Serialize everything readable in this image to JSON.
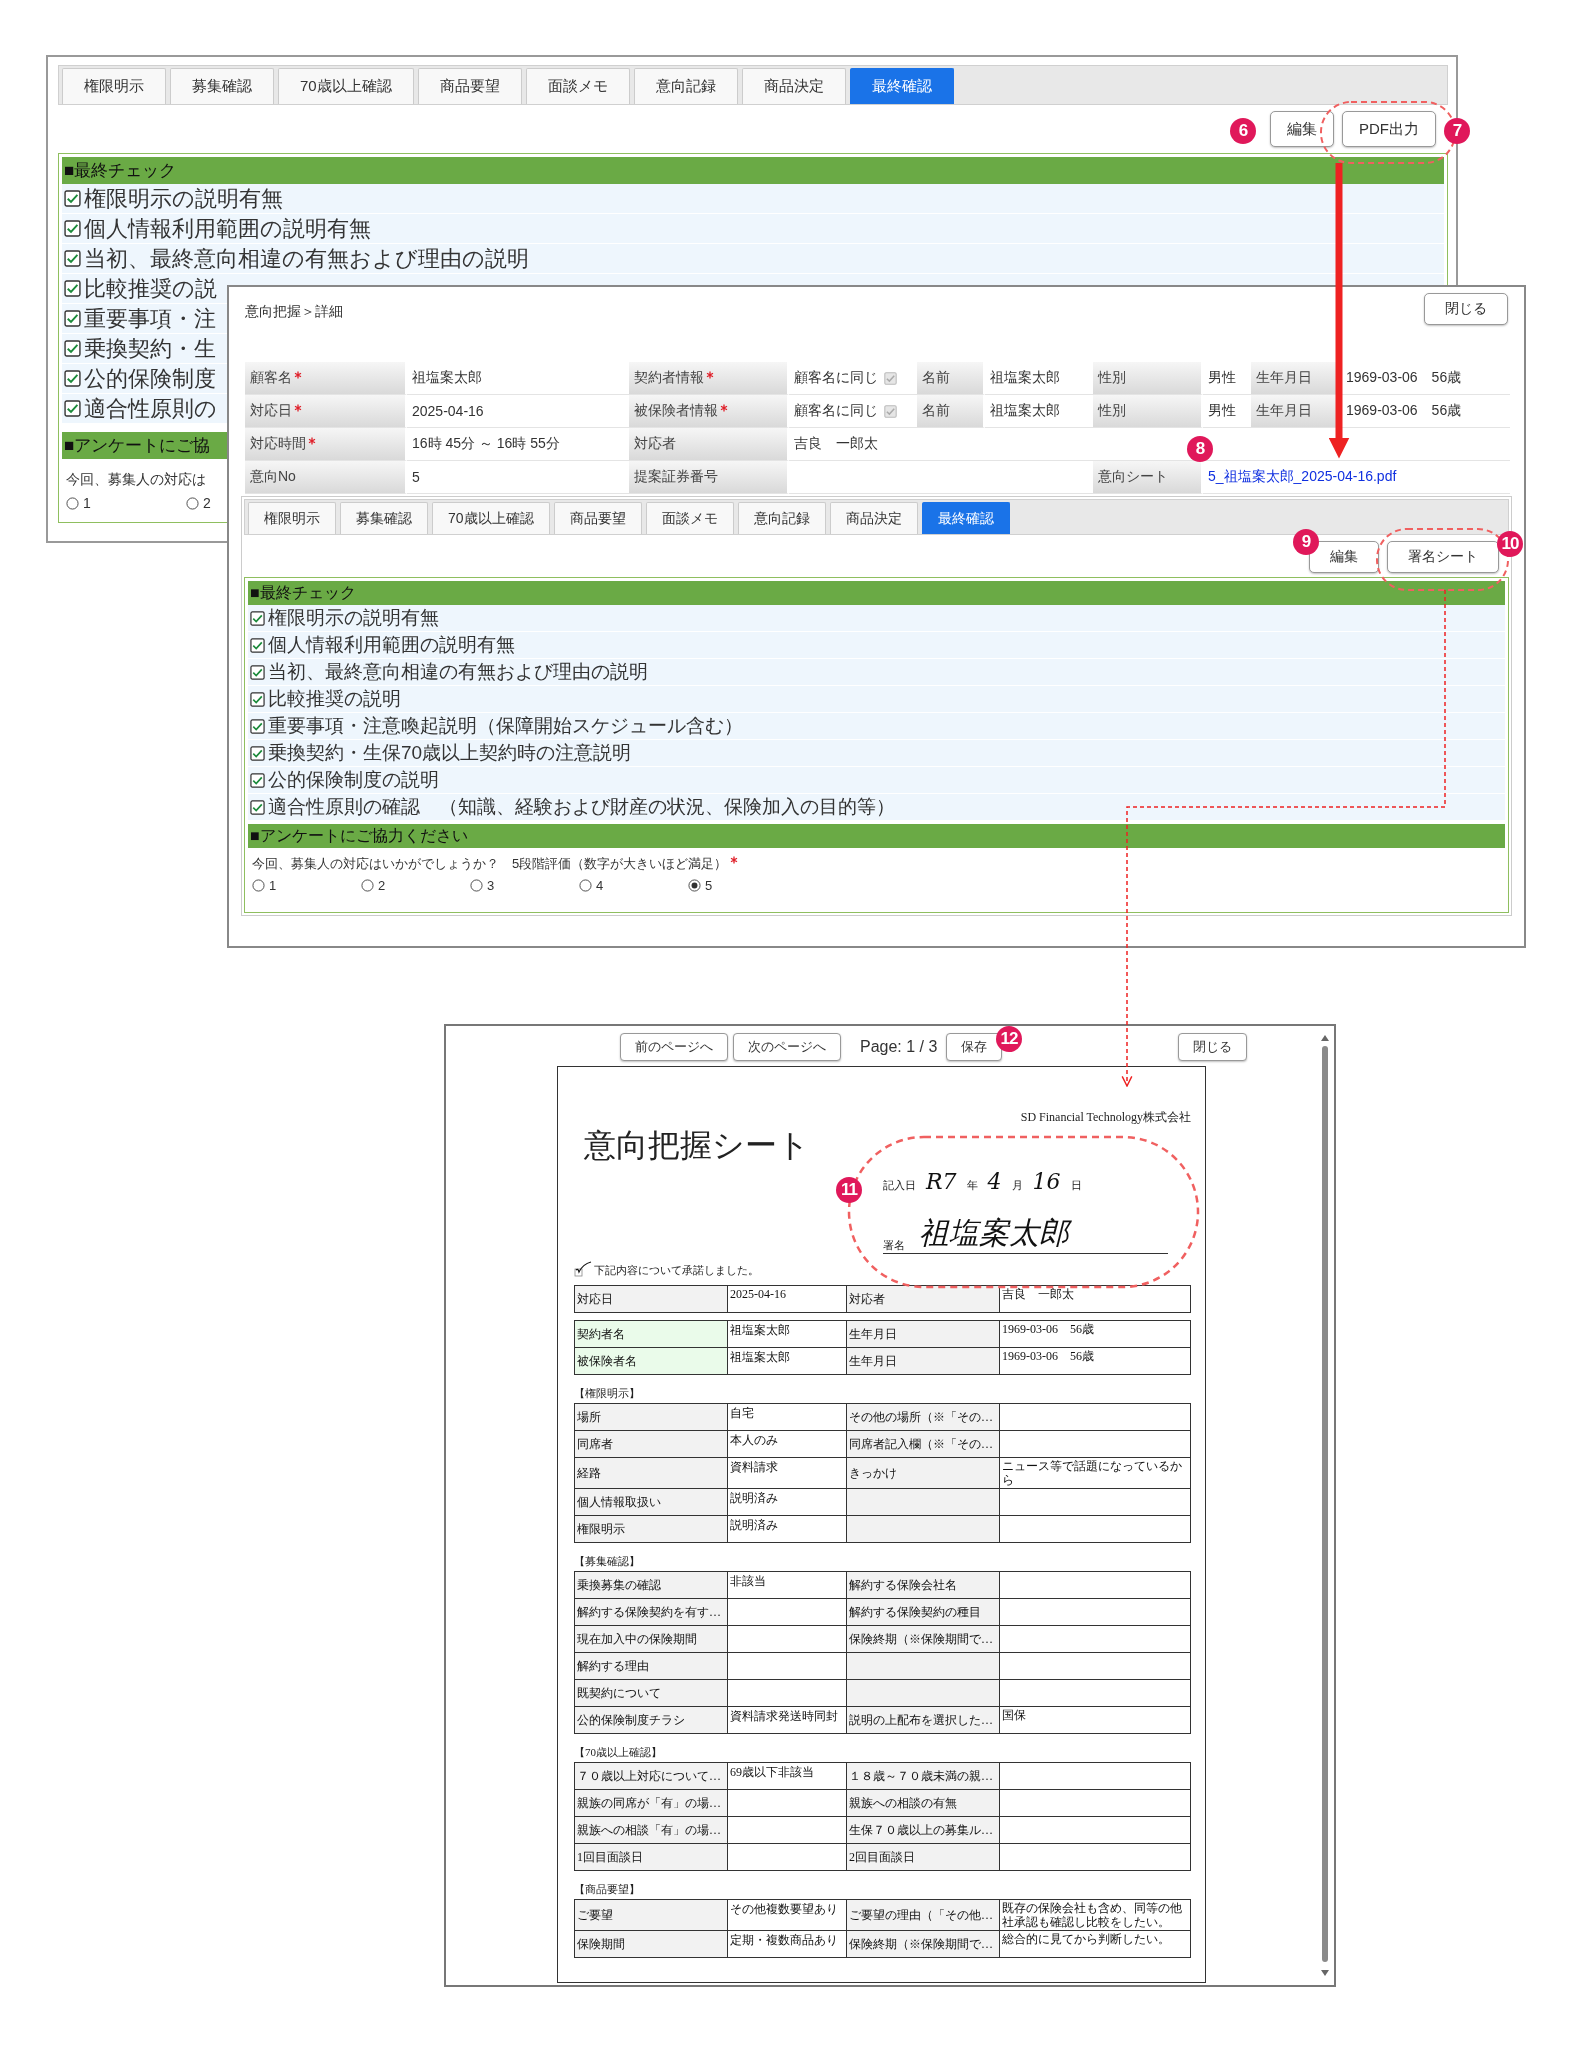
{
  "background_window": {
    "tabs": [
      {
        "label": "権限明示",
        "selected": false
      },
      {
        "label": "募集確認",
        "selected": false
      },
      {
        "label": "70歳以上確認",
        "selected": false
      },
      {
        "label": "商品要望",
        "selected": false
      },
      {
        "label": "面談メモ",
        "selected": false
      },
      {
        "label": "意向記録",
        "selected": false
      },
      {
        "label": "商品決定",
        "selected": false
      },
      {
        "label": "最終確認",
        "selected": true
      }
    ],
    "buttons": [
      {
        "label": "編集"
      },
      {
        "label": "PDF出力"
      }
    ],
    "final_check": {
      "title": "■最終チェック",
      "items": [
        {
          "label": "権限明示の説明有無",
          "checked": true
        },
        {
          "label": "個人情報利用範囲の説明有無",
          "checked": true
        },
        {
          "label": "当初、最終意向相違の有無および理由の説明",
          "checked": true
        },
        {
          "label": "比較推奨の説",
          "checked": true
        },
        {
          "label": "重要事項・注",
          "checked": true
        },
        {
          "label": "乗換契約・生",
          "checked": true
        },
        {
          "label": "公的保険制度",
          "checked": true
        },
        {
          "label": "適合性原則の",
          "checked": true
        }
      ]
    },
    "survey": {
      "title": "■アンケートにご協",
      "question": "今回、募集人の対応は",
      "options": [
        {
          "label": "1",
          "selected": false
        },
        {
          "label": "2",
          "selected": false
        }
      ]
    }
  },
  "detail_window": {
    "breadcrumb": "意向把握＞詳細",
    "close_button": "閉じる",
    "info_rows": [
      {
        "cells": [
          {
            "kind": "label",
            "text": "顧客名",
            "required": true
          },
          {
            "kind": "value",
            "text": "祖塩案太郎"
          },
          {
            "kind": "label",
            "text": "契約者情報",
            "required": true
          },
          {
            "kind": "check",
            "text": "顧客名に同じ",
            "checked": true
          },
          {
            "kind": "label",
            "text": "名前",
            "required": false
          },
          {
            "kind": "value",
            "text": "祖塩案太郎"
          },
          {
            "kind": "label",
            "text": "性別",
            "required": false
          },
          {
            "kind": "value",
            "text": "男性"
          },
          {
            "kind": "label",
            "text": "生年月日",
            "required": false
          },
          {
            "kind": "value",
            "text": "1969-03-06　56歳"
          }
        ]
      },
      {
        "cells": [
          {
            "kind": "label",
            "text": "対応日",
            "required": true
          },
          {
            "kind": "value",
            "text": "2025-04-16"
          },
          {
            "kind": "label",
            "text": "被保険者情報",
            "required": true
          },
          {
            "kind": "check",
            "text": "顧客名に同じ",
            "checked": true
          },
          {
            "kind": "label",
            "text": "名前",
            "required": false
          },
          {
            "kind": "value",
            "text": "祖塩案太郎"
          },
          {
            "kind": "label",
            "text": "性別",
            "required": false
          },
          {
            "kind": "value",
            "text": "男性"
          },
          {
            "kind": "label",
            "text": "生年月日",
            "required": false
          },
          {
            "kind": "value",
            "text": "1969-03-06　56歳"
          }
        ]
      },
      {
        "cells": [
          {
            "kind": "label",
            "text": "対応時間",
            "required": true
          },
          {
            "kind": "value",
            "text": "16時 45分 ～ 16時 55分"
          },
          {
            "kind": "label",
            "text": "対応者",
            "required": false
          },
          {
            "kind": "value",
            "text": "吉良　一郎太"
          }
        ]
      },
      {
        "cells": [
          {
            "kind": "label",
            "text": "意向No",
            "required": false
          },
          {
            "kind": "value",
            "text": "5"
          },
          {
            "kind": "label",
            "text": "提案証券番号",
            "required": false
          },
          {
            "kind": "blank"
          },
          {
            "kind": "label",
            "text": "意向シート",
            "required": false
          },
          {
            "kind": "link",
            "text": "5_祖塩案太郎_2025-04-16.pdf"
          }
        ]
      }
    ],
    "tabs": [
      {
        "label": "権限明示",
        "selected": false
      },
      {
        "label": "募集確認",
        "selected": false
      },
      {
        "label": "70歳以上確認",
        "selected": false
      },
      {
        "label": "商品要望",
        "selected": false
      },
      {
        "label": "面談メモ",
        "selected": false
      },
      {
        "label": "意向記録",
        "selected": false
      },
      {
        "label": "商品決定",
        "selected": false
      },
      {
        "label": "最終確認",
        "selected": true
      }
    ],
    "buttons": [
      {
        "label": "編集"
      },
      {
        "label": "署名シート"
      }
    ],
    "final_check": {
      "title": "■最終チェック",
      "items": [
        {
          "label": "権限明示の説明有無",
          "checked": true
        },
        {
          "label": "個人情報利用範囲の説明有無",
          "checked": true
        },
        {
          "label": "当初、最終意向相違の有無および理由の説明",
          "checked": true
        },
        {
          "label": "比較推奨の説明",
          "checked": true
        },
        {
          "label": "重要事項・注意喚起説明（保障開始スケジュール含む）",
          "checked": true
        },
        {
          "label": "乗換契約・生保70歳以上契約時の注意説明",
          "checked": true
        },
        {
          "label": "公的保険制度の説明",
          "checked": true
        },
        {
          "label": "適合性原則の確認　（知識、経験および財産の状況、保険加入の目的等）",
          "checked": true
        }
      ]
    },
    "survey": {
      "title": "■アンケートにご協力ください",
      "question": "今回、募集人の対応はいかがでしょうか？　5段階評価（数字が大きいほど満足）",
      "required": true,
      "options": [
        {
          "label": "1",
          "selected": false
        },
        {
          "label": "2",
          "selected": false
        },
        {
          "label": "3",
          "selected": false
        },
        {
          "label": "4",
          "selected": false
        },
        {
          "label": "5",
          "selected": true
        }
      ]
    }
  },
  "pdf_viewer": {
    "toolbar": {
      "prev_button": "前のページへ",
      "next_button": "次のページへ",
      "page_indicator": "Page: 1 / 3",
      "save_button": "保存",
      "close_button": "閉じる"
    },
    "page": {
      "company": "SD Financial Technology株式会社",
      "title": "意向把握シート",
      "entry_date": {
        "label": "記入日",
        "era_year": "R7",
        "year_unit": "年",
        "month": "4",
        "month_unit": "月",
        "day": "16",
        "day_unit": "日"
      },
      "signature": {
        "label": "署名",
        "name": "祖塩案太郎"
      },
      "consent": {
        "label": "下記内容について承諾しました。",
        "checked": true
      },
      "tables": [
        {
          "kind": "plain",
          "rows": [
            {
              "label_1": "対応日",
              "value_1": "2025-04-16",
              "label_2": "対応者",
              "value_2": "吉良　一郎太"
            }
          ]
        },
        {
          "kind": "persons",
          "rows": [
            {
              "label_1": "契約者名",
              "value_1": "祖塩案太郎",
              "label_2": "生年月日",
              "value_2": "1969-03-06　56歳"
            },
            {
              "label_1": "被保険者名",
              "value_1": "祖塩案太郎",
              "label_2": "生年月日",
              "value_2": "1969-03-06　56歳"
            }
          ]
        },
        {
          "kind": "plain",
          "title": "【権限明示】",
          "rows": [
            {
              "label_1": "場所",
              "value_1": "自宅",
              "label_2": "その他の場所（※「その…"
            },
            {
              "label_1": "同席者",
              "value_1": "本人のみ",
              "label_2": "同席者記入欄（※「その…"
            },
            {
              "label_1": "経路",
              "value_1": "資料請求",
              "label_2": "きっかけ",
              "value_2": "ニュース等で話題になっているから"
            },
            {
              "label_1": "個人情報取扱い",
              "value_1": "説明済み"
            },
            {
              "label_1": "権限明示",
              "value_1": "説明済み"
            }
          ]
        },
        {
          "kind": "plain",
          "title": "【募集確認】",
          "rows": [
            {
              "label_1": "乗換募集の確認",
              "value_1": "非該当",
              "label_2": "解約する保険会社名"
            },
            {
              "label_1": "解約する保険契約を有す…",
              "label_2": "解約する保険契約の種目"
            },
            {
              "label_1": "現在加入中の保険期間",
              "label_2": "保険終期（※保険期間で…"
            },
            {
              "label_1": "解約する理由"
            },
            {
              "label_1": "既契約について"
            },
            {
              "label_1": "公的保険制度チラシ",
              "value_1": "資料請求発送時同封",
              "label_2": "説明の上配布を選択した…",
              "value_2": "国保"
            }
          ]
        },
        {
          "kind": "plain",
          "title": "【70歳以上確認】",
          "rows": [
            {
              "label_1": "７０歳以上対応について…",
              "value_1": "69歳以下非該当",
              "label_2": "１８歳～７０歳未満の親…"
            },
            {
              "label_1": "親族の同席が「有」の場…",
              "label_2": "親族への相談の有無"
            },
            {
              "label_1": "親族への相談「有」の場…",
              "label_2": "生保７０歳以上の募集ル…"
            },
            {
              "label_1": "1回目面談日",
              "label_2": "2回目面談日"
            }
          ]
        },
        {
          "kind": "plain",
          "title": "【商品要望】",
          "rows": [
            {
              "label_1": "ご要望",
              "value_1": "その他複数要望あり",
              "label_2": "ご要望の理由（「その他…",
              "value_2": "既存の保険会社も含め、同等の他社承認も確認し比較をしたい。"
            },
            {
              "label_1": "保険期間",
              "value_1": "定期・複数商品あり",
              "label_2": "保険終期（※保険期間で…",
              "value_2": "総合的に見てから判断したい。"
            }
          ]
        }
      ]
    }
  },
  "callouts": [
    {
      "label": "6"
    },
    {
      "label": "7"
    },
    {
      "label": "8"
    },
    {
      "label": "9"
    },
    {
      "label": "10"
    },
    {
      "label": "11"
    },
    {
      "label": "12"
    }
  ]
}
